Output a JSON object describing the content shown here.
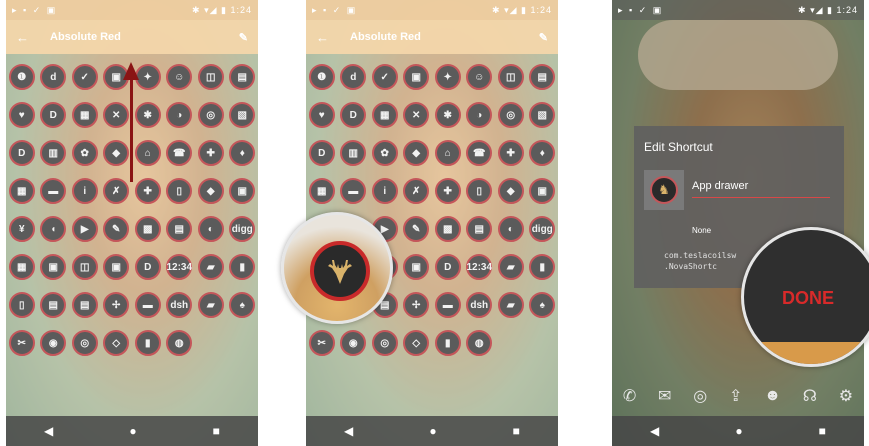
{
  "status": {
    "left_icons": "▸ ▪ ✓ ▣",
    "right_text": "✱ ▾◢ ▮ 1:24"
  },
  "appbar": {
    "back_icon": "←",
    "title": "Absolute Red",
    "edit_icon": "✎"
  },
  "icons": [
    "❶",
    "d",
    "✓",
    "▣",
    "✦",
    "☺",
    "◫",
    "▤",
    "♥",
    "D",
    "▦",
    "✕",
    "✱",
    "◑",
    "◎",
    "▧",
    "D",
    "▥",
    "✿",
    "◆",
    "⌂",
    "☎",
    "✚",
    "♦",
    "▦",
    "▬",
    "i",
    "✗",
    "✚",
    "▯",
    "◆",
    "▣",
    "¥",
    "◖",
    "▶",
    "✎",
    "▩",
    "▤",
    "◐",
    "digg",
    "▦",
    "▣",
    "◫",
    "▣",
    "D",
    "12:34",
    "▰",
    "▮",
    "▯",
    "▤",
    "▤",
    "✢",
    "▬",
    "dsh",
    "▰",
    "♠",
    "✂",
    "◉",
    "◎",
    "◇",
    "▮",
    "◍"
  ],
  "nav": {
    "back": "◀",
    "home": "●",
    "recent": "■"
  },
  "dialog": {
    "title": "Edit Shortcut",
    "field_value": "App drawer",
    "none_label": "None",
    "package": "com.teslacoilsw\n.NovaShortc"
  },
  "done_label": "DONE",
  "dock_icons": [
    "✆",
    "✉",
    "◎",
    "⇪",
    "☻",
    "☊",
    "⚙"
  ],
  "colors": {
    "accent": "#d82a2a",
    "icon_ring": "#c4565a"
  }
}
